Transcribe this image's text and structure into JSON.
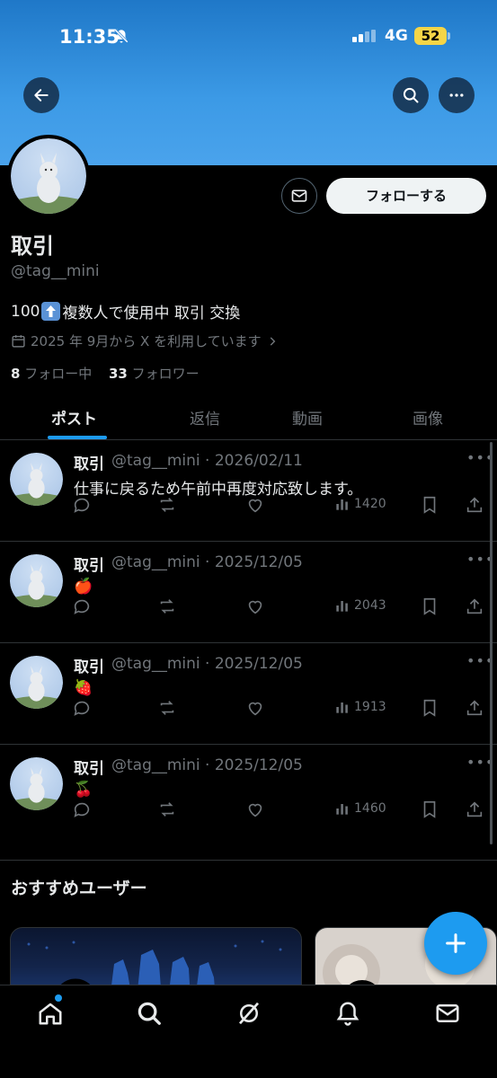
{
  "status": {
    "time": "11:35",
    "network": "4G",
    "battery": "52"
  },
  "profile": {
    "name": "取引",
    "handle": "@tag__mini",
    "bio_prefix": "100",
    "bio_suffix": "複数人で使用中 取引 交換",
    "joined": "2025 年 9月から X を利用しています",
    "following_count": "8",
    "following_label": " フォロー中",
    "followers_count": "33",
    "followers_label": " フォロワー",
    "follow_button": "フォローする"
  },
  "tabs": [
    "ポスト",
    "返信",
    "動画",
    "画像"
  ],
  "posts": [
    {
      "name": "取引",
      "meta": "@tag__mini · 2026/02/11",
      "text": "仕事に戻るため午前中再度対応致します。",
      "views": "1420"
    },
    {
      "name": "取引",
      "meta": "@tag__mini · 2025/12/05",
      "text": "🍎",
      "views": "2043"
    },
    {
      "name": "取引",
      "meta": "@tag__mini · 2025/12/05",
      "text": "🍓",
      "views": "1913"
    },
    {
      "name": "取引",
      "meta": "@tag__mini · 2025/12/05",
      "text": "🍒",
      "views": "1460"
    }
  ],
  "recommended": {
    "title": "おすすめユーザー"
  },
  "colors": {
    "accent": "#1d9bf0",
    "banner": "#3c9ae6",
    "muted": "#71767b"
  }
}
